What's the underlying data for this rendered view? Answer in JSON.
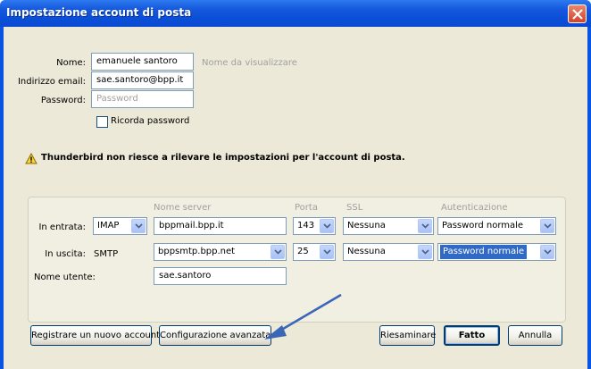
{
  "window": {
    "title": "Impostazione account di posta"
  },
  "identity": {
    "name_label": "Nome:",
    "name_value": "emanuele santoro",
    "name_hint": "Nome da visualizzare",
    "email_label": "Indirizzo email:",
    "email_value": "sae.santoro@bpp.it",
    "password_label": "Password:",
    "password_placeholder": "Password",
    "remember_label": "Ricorda password",
    "remember_checked": false
  },
  "warning": {
    "text": "Thunderbird non riesce a rilevare le impostazioni per l'account di posta."
  },
  "servers": {
    "headers": {
      "server": "Nome server",
      "port": "Porta",
      "ssl": "SSL",
      "auth": "Autenticazione"
    },
    "incoming": {
      "label": "In entrata:",
      "protocol": "IMAP",
      "server": "bppmail.bpp.it",
      "port": "143",
      "ssl": "Nessuna",
      "auth": "Password normale"
    },
    "outgoing": {
      "label": "In uscita:",
      "protocol": "SMTP",
      "server": "bppsmtp.bpp.net",
      "port": "25",
      "ssl": "Nessuna",
      "auth": "Password normale"
    },
    "username_label": "Nome utente:",
    "username_value": "sae.santoro"
  },
  "buttons": {
    "new_account": "Registrare un nuovo account",
    "advanced": "Configurazione avanzata",
    "retest": "Riesaminare",
    "done": "Fatto",
    "cancel": "Annulla"
  },
  "colors": {
    "titlebar": "#0b4fd8",
    "dialog_bg": "#ece9d8",
    "annotation_arrow": "#3a66b8",
    "selection": "#316ac5"
  }
}
